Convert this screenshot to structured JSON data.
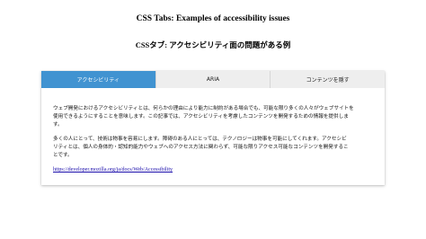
{
  "page": {
    "title": "CSS Tabs: Examples of accessibility issues",
    "subtitle": "CSSタブ: アクセシビリティ面の問題がある例"
  },
  "tabs": [
    {
      "label": "アクセシビリティ",
      "active": true
    },
    {
      "label": "ARIA",
      "active": false
    },
    {
      "label": "コンテンツを隠す",
      "active": false
    }
  ],
  "content": {
    "paragraph1_line1": "ウェブ開発におけるアクセシビリティとは、何らかの理由により能力に制約がある場合でも、可能な限り多くの人々がウェブサイトを",
    "paragraph1_line2": "使用できるようにすることを意味します。この記事では、アクセシビリティを考慮したコンテンツを開発するための情報を提供しま",
    "paragraph1_line3": "す。",
    "paragraph2_line1": "多くの人にとって、技術は物事を容易にします。障碍のある人にとっては、テクノロジーは物事を可能にしてくれます。アクセシビ",
    "paragraph2_line2": "リティとは、個人の身体的・認知的能力やウェブへのアクセス方法に関わらず、可能な限りアクセス可能なコンテンツを開発するこ",
    "paragraph2_line3": "とです。",
    "link_text": "https://developer.mozilla.org/ja/docs/Web/Accessibility"
  },
  "colors": {
    "active_tab": "#4193d1",
    "inactive_tab": "#eeeeee",
    "link": "#1a0dab"
  }
}
